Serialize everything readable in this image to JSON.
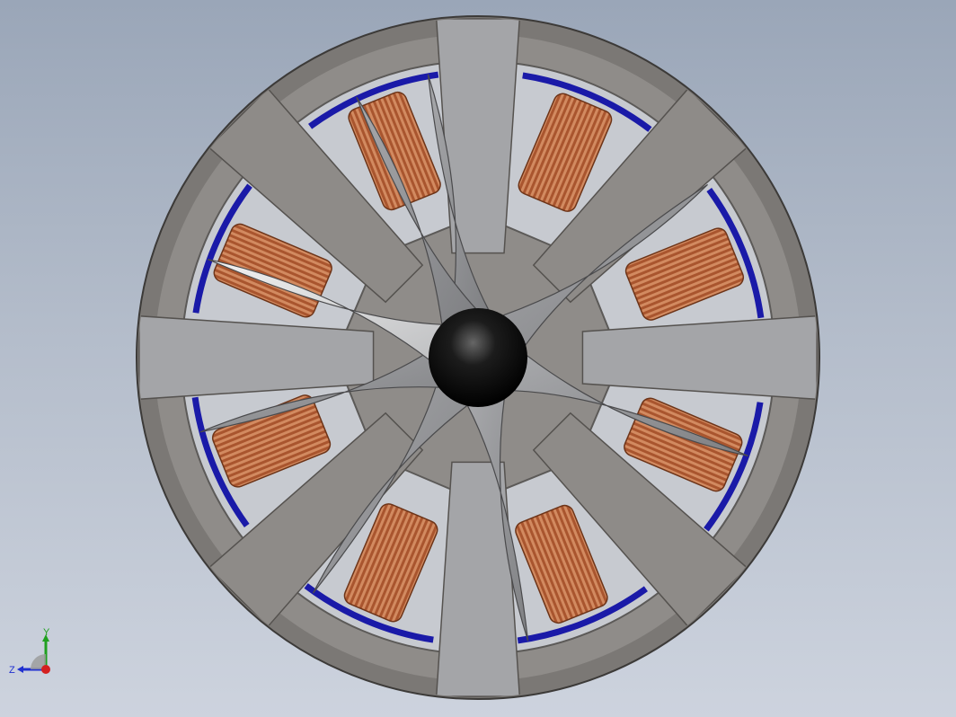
{
  "viewport": {
    "background_top": "#9aa6b8",
    "background_bottom": "#cdd3de"
  },
  "model": {
    "housing_color": "#8d8a86",
    "housing_dark": "#6e6b68",
    "blade_light": "#cfd0d2",
    "blade_mid": "#a9aaad",
    "coil_color": "#b8663d",
    "magnet_color": "#1a1aa8",
    "hub_color": "#111111"
  },
  "triad": {
    "y_label": "Y",
    "z_label": "Z",
    "x_color": "#d42020",
    "y_color": "#20a020",
    "z_color": "#2030d0"
  }
}
